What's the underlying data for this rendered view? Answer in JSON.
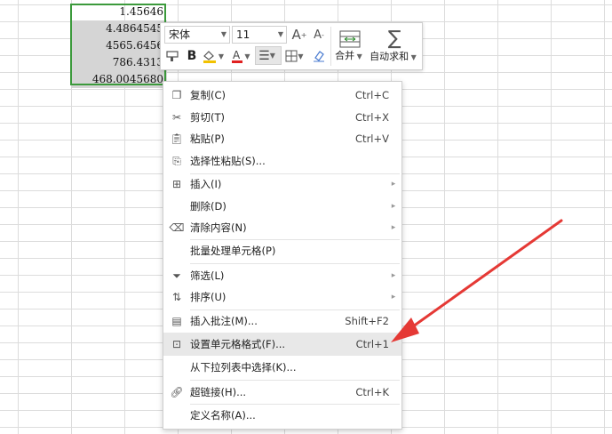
{
  "sheet": {
    "cells": [
      "1.45646",
      "4.4864545",
      "4565.6456",
      "786.4313",
      "468.0045680"
    ]
  },
  "mini_toolbar": {
    "font_name": "宋体",
    "font_size": "11",
    "grow_font": "A",
    "shrink_font": "A",
    "bold": "B",
    "merge_label": "合并",
    "autosum_label": "自动求和"
  },
  "context_menu": {
    "items": [
      {
        "label": "复制(C)",
        "shortcut": "Ctrl+C"
      },
      {
        "label": "剪切(T)",
        "shortcut": "Ctrl+X"
      },
      {
        "label": "粘贴(P)",
        "shortcut": "Ctrl+V"
      },
      {
        "label": "选择性粘贴(S)..."
      },
      {
        "label": "插入(I)"
      },
      {
        "label": "删除(D)"
      },
      {
        "label": "清除内容(N)"
      },
      {
        "label": "批量处理单元格(P)"
      },
      {
        "label": "筛选(L)"
      },
      {
        "label": "排序(U)"
      },
      {
        "label": "插入批注(M)...",
        "shortcut": "Shift+F2"
      },
      {
        "label": "设置单元格格式(F)...",
        "shortcut": "Ctrl+1"
      },
      {
        "label": "从下拉列表中选择(K)..."
      },
      {
        "label": "超链接(H)...",
        "shortcut": "Ctrl+K"
      },
      {
        "label": "定义名称(A)..."
      }
    ]
  },
  "colors": {
    "selection_border": "#3c9a3c",
    "arrow": "#e53935",
    "highlight_row": "#e8e8e8"
  }
}
